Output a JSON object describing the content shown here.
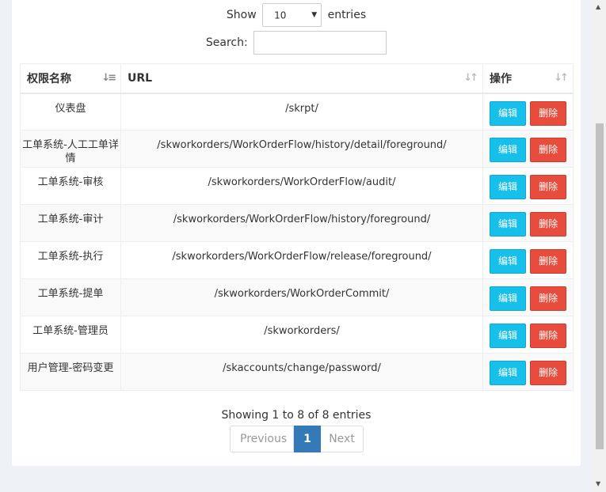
{
  "length": {
    "show_label": "Show",
    "selected": "10",
    "entries_label": "entries"
  },
  "search": {
    "label": "Search:",
    "value": ""
  },
  "table": {
    "headers": [
      "权限名称",
      "URL",
      "操作"
    ],
    "rows": [
      {
        "name": "仪表盘",
        "url": "/skrpt/"
      },
      {
        "name": "工单系统-人工工单详情",
        "url": "/skworkorders/WorkOrderFlow/history/detail/foreground/"
      },
      {
        "name": "工单系统-审核",
        "url": "/skworkorders/WorkOrderFlow/audit/"
      },
      {
        "name": "工单系统-审计",
        "url": "/skworkorders/WorkOrderFlow/history/foreground/"
      },
      {
        "name": "工单系统-执行",
        "url": "/skworkorders/WorkOrderFlow/release/foreground/"
      },
      {
        "name": "工单系统-提单",
        "url": "/skworkorders/WorkOrderCommit/"
      },
      {
        "name": "工单系统-管理员",
        "url": "/skworkorders/"
      },
      {
        "name": "用户管理-密码变更",
        "url": "/skaccounts/change/password/"
      }
    ],
    "edit_label": "编辑",
    "delete_label": "删除"
  },
  "info": "Showing 1 to 8 of 8 entries",
  "pager": {
    "previous": "Previous",
    "current": "1",
    "next": "Next"
  },
  "colors": {
    "edit": "#17c0eb",
    "delete": "#e74c3c",
    "active_page": "#337ab7"
  }
}
